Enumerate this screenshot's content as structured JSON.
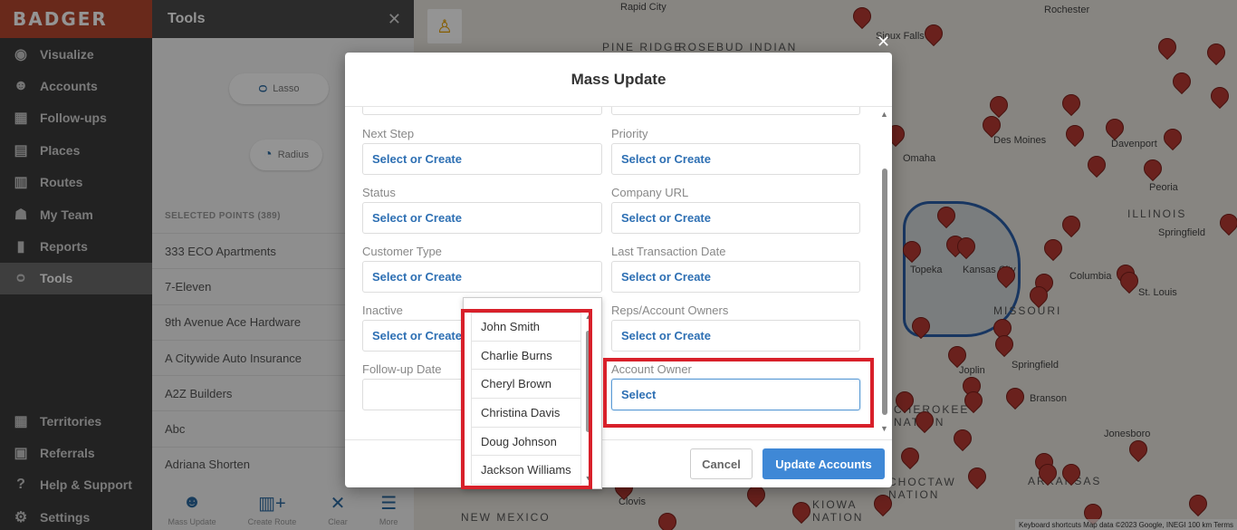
{
  "sidebar": {
    "logo": "BADGER",
    "nav": [
      {
        "label": "Visualize",
        "icon": "eye-icon"
      },
      {
        "label": "Accounts",
        "icon": "user-circle-icon"
      },
      {
        "label": "Follow-ups",
        "icon": "calendar-icon"
      },
      {
        "label": "Places",
        "icon": "building-icon"
      },
      {
        "label": "Routes",
        "icon": "map-icon"
      },
      {
        "label": "My Team",
        "icon": "team-icon"
      },
      {
        "label": "Reports",
        "icon": "chart-icon"
      },
      {
        "label": "Tools",
        "icon": "lasso-icon",
        "active": true
      }
    ],
    "nav_bottom": [
      {
        "label": "Territories",
        "icon": "grid-icon"
      },
      {
        "label": "Referrals",
        "icon": "gift-icon"
      },
      {
        "label": "Help & Support",
        "icon": "help-icon"
      },
      {
        "label": "Settings",
        "icon": "gear-icon"
      }
    ]
  },
  "tools": {
    "title": "Tools",
    "lasso": "Lasso",
    "radius": "Radius",
    "selected_points": "SELECTED POINTS (389)",
    "points": [
      "333 ECO Apartments",
      "7-Eleven",
      "9th Avenue Ace Hardware",
      "A Citywide Auto Insurance",
      "A2Z Builders",
      "Abc",
      "Adriana Shorten"
    ],
    "footer": [
      "Mass Update",
      "Create Route",
      "Clear",
      "More"
    ]
  },
  "map": {
    "labels": [
      "Rapid City",
      "Rochester",
      "PINE RIDGE",
      "ROSEBUD INDIAN",
      "Sioux Falls",
      "Des Moines",
      "Davenport",
      "Omaha",
      "Peoria",
      "ILLINOIS",
      "Springfield",
      "Topeka",
      "Kansas City",
      "Columbia",
      "St. Louis",
      "MISSOURI",
      "Joplin",
      "Springfield",
      "CHEROKEE NATION",
      "Branson",
      "Jonesboro",
      "ARKANSAS",
      "NEW MEXICO",
      "Clovis",
      "CHOCTAW NATION",
      "KIOWA NATION"
    ],
    "attribution": "Keyboard shortcuts   Map data ©2023 Google, INEGI   100 km   Terms"
  },
  "modal": {
    "title": "Mass Update",
    "fields": [
      {
        "label": "Next Step",
        "value": "Select or Create"
      },
      {
        "label": "Priority",
        "value": "Select or Create"
      },
      {
        "label": "Status",
        "value": "Select or Create"
      },
      {
        "label": "Company URL",
        "value": "Select or Create"
      },
      {
        "label": "Customer Type",
        "value": "Select or Create"
      },
      {
        "label": "Last Transaction Date",
        "value": "Select or Create"
      },
      {
        "label": "Inactive",
        "value": "Select or Create"
      },
      {
        "label": "Reps/Account Owners",
        "value": "Select or Create"
      },
      {
        "label": "Follow-up Date",
        "value": ""
      },
      {
        "label": "Account Owner",
        "value": "Select"
      }
    ],
    "dropdown_options": [
      "John Smith",
      "Charlie Burns",
      "Cheryl Brown",
      "Christina Davis",
      "Doug Johnson",
      "Jackson Williams"
    ],
    "cancel": "Cancel",
    "update": "Update Accounts"
  },
  "colors": {
    "primary": "#3f88d6",
    "link": "#2d6fb3",
    "highlight": "#d8202a",
    "pin": "#b73a33",
    "logo_bg": "#b5472f"
  }
}
